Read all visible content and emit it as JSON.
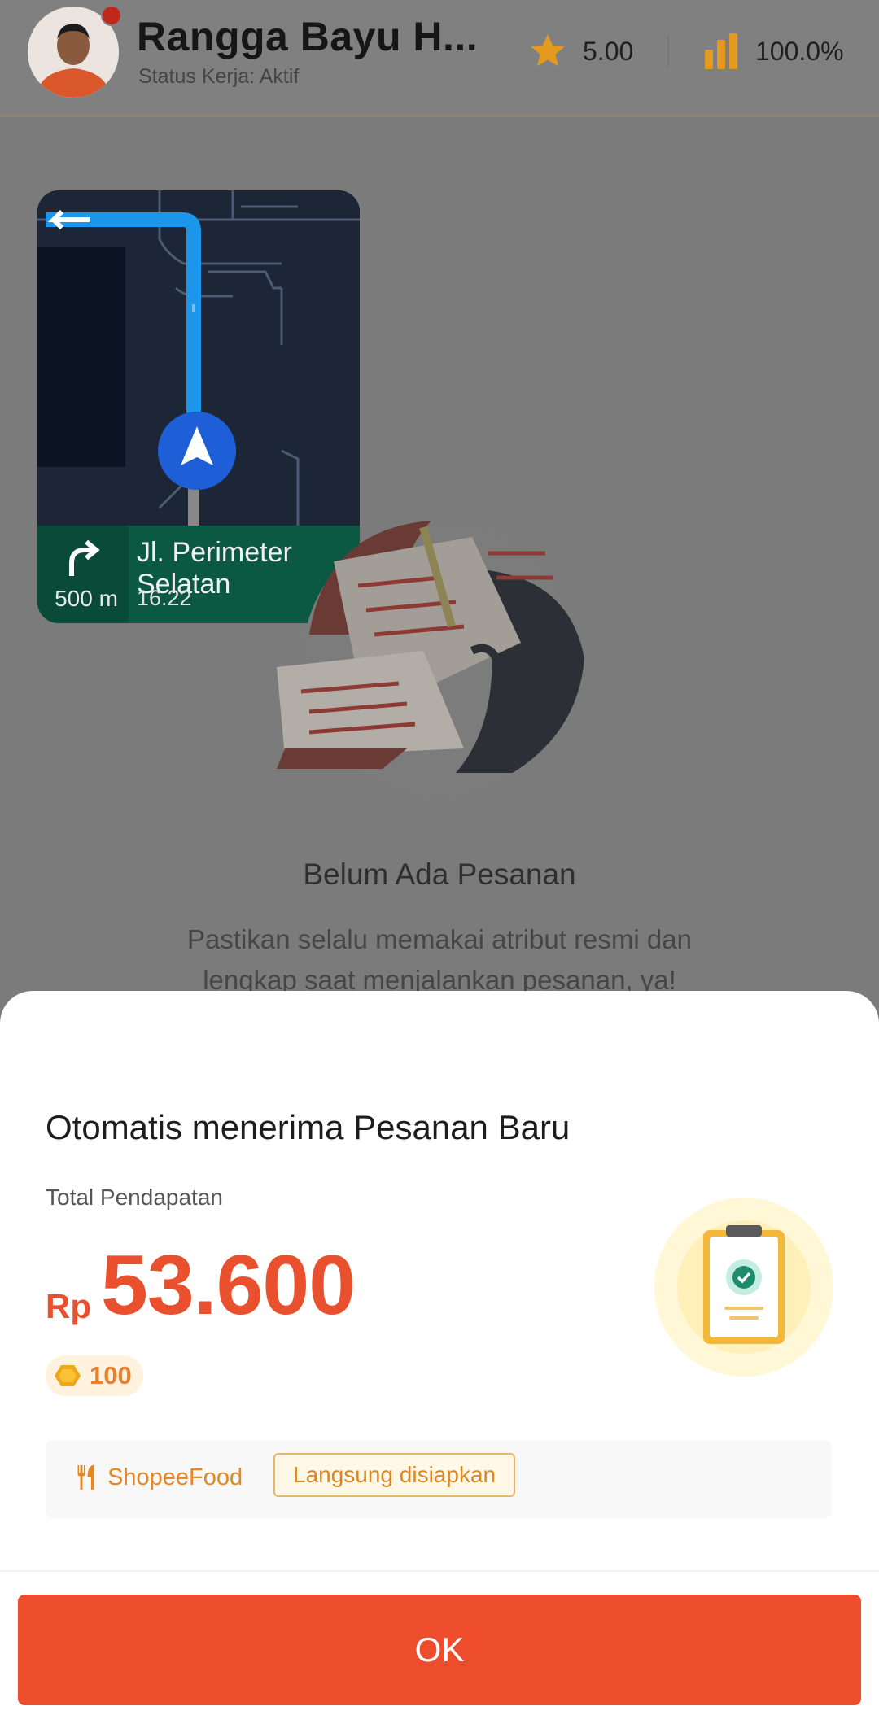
{
  "header": {
    "driver_name": "Rangga Bayu H...",
    "status_text": "Status Kerja: Aktif",
    "rating": "5.00",
    "performance": "100.0%",
    "icons": {
      "rating": "star-icon",
      "performance": "bar-chart-icon"
    },
    "colors": {
      "icon": "#e39a1e"
    }
  },
  "navigation": {
    "distance": "500 m",
    "street": "Jl. Perimeter Selatan",
    "time": "16.22",
    "icons": {
      "turn": "turn-right-arrow-icon",
      "position": "navigation-arrow-icon"
    }
  },
  "empty_state": {
    "title": "Belum Ada Pesanan",
    "description": "Pastikan selalu memakai atribut resmi dan lengkap saat menjalankan pesanan, ya!"
  },
  "order_sheet": {
    "title": "Otomatis menerima Pesanan Baru",
    "earnings_label": "Total Pendapatan",
    "currency": "Rp",
    "amount": "53.600",
    "coins": "100",
    "service_name": "ShopeeFood",
    "service_tag": "Langsung disiapkan",
    "ok_label": "OK",
    "icons": {
      "coin": "coin-icon",
      "service": "fork-knife-icon",
      "illustration": "clipboard-check-icon"
    },
    "colors": {
      "accent": "#ee4d2d",
      "service": "#e58722"
    }
  }
}
